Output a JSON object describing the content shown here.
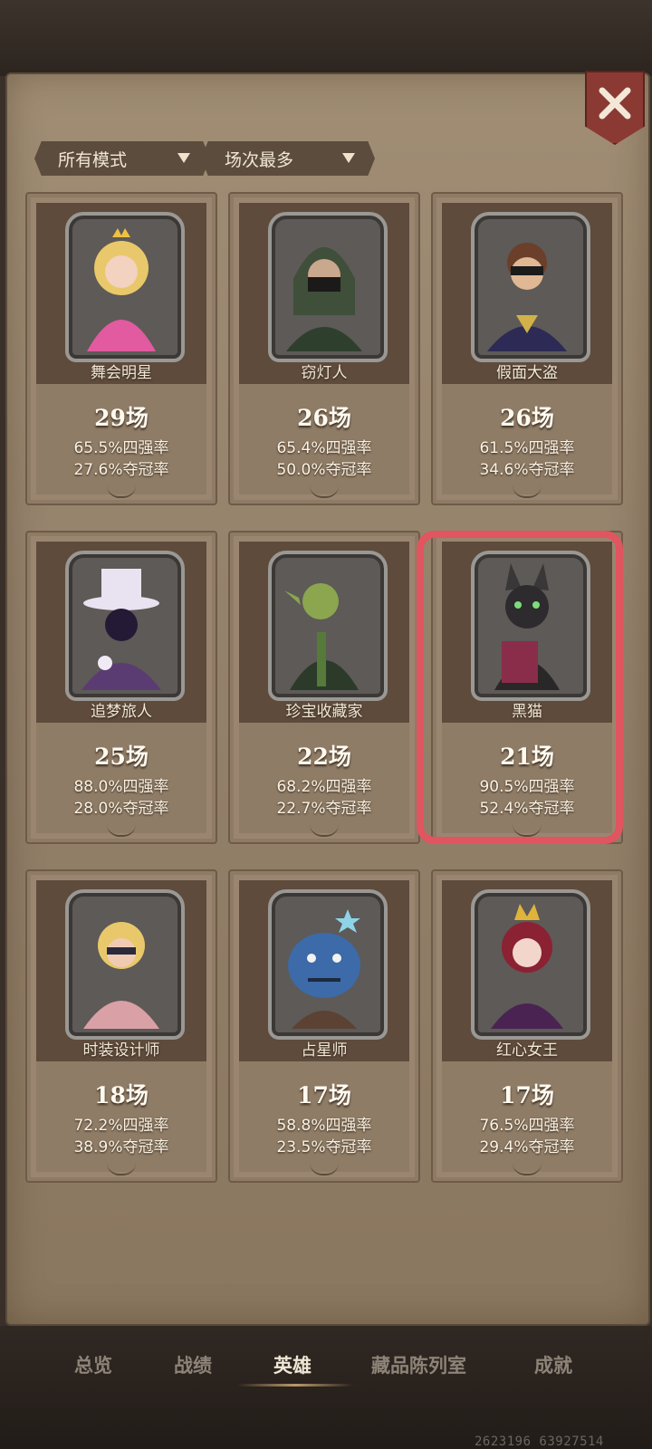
{
  "filters": {
    "mode_label": "所有模式",
    "sort_label": "场次最多"
  },
  "heroes": [
    {
      "name": "舞会明星",
      "matches": "29场",
      "top4": "65.5%四强率",
      "win": "27.6%夺冠率",
      "color": "#e8c86a"
    },
    {
      "name": "窃灯人",
      "matches": "26场",
      "top4": "65.4%四强率",
      "win": "50.0%夺冠率",
      "color": "#3f4f3a"
    },
    {
      "name": "假面大盗",
      "matches": "26场",
      "top4": "61.5%四强率",
      "win": "34.6%夺冠率",
      "color": "#2d2a55"
    },
    {
      "name": "追梦旅人",
      "matches": "25场",
      "top4": "88.0%四强率",
      "win": "28.0%夺冠率",
      "color": "#5a3c72"
    },
    {
      "name": "珍宝收藏家",
      "matches": "22场",
      "top4": "68.2%四强率",
      "win": "22.7%夺冠率",
      "color": "#557a3a"
    },
    {
      "name": "黑猫",
      "matches": "21场",
      "top4": "90.5%四强率",
      "win": "52.4%夺冠率",
      "color": "#2e2b2e"
    },
    {
      "name": "时装设计师",
      "matches": "18场",
      "top4": "72.2%四强率",
      "win": "38.9%夺冠率",
      "color": "#d9a0a6"
    },
    {
      "name": "占星师",
      "matches": "17场",
      "top4": "58.8%四强率",
      "win": "23.5%夺冠率",
      "color": "#3d6aa8"
    },
    {
      "name": "红心女王",
      "matches": "17场",
      "top4": "76.5%四强率",
      "win": "29.4%夺冠率",
      "color": "#8a2233"
    }
  ],
  "nav": {
    "overview": "总览",
    "record": "战绩",
    "heroes": "英雄",
    "collection": "藏品陈列室",
    "achievements": "成就"
  },
  "watermark": "2623196 63927514",
  "colors": {
    "highlight": "#e0555f",
    "close_button": "#8a3a33"
  }
}
